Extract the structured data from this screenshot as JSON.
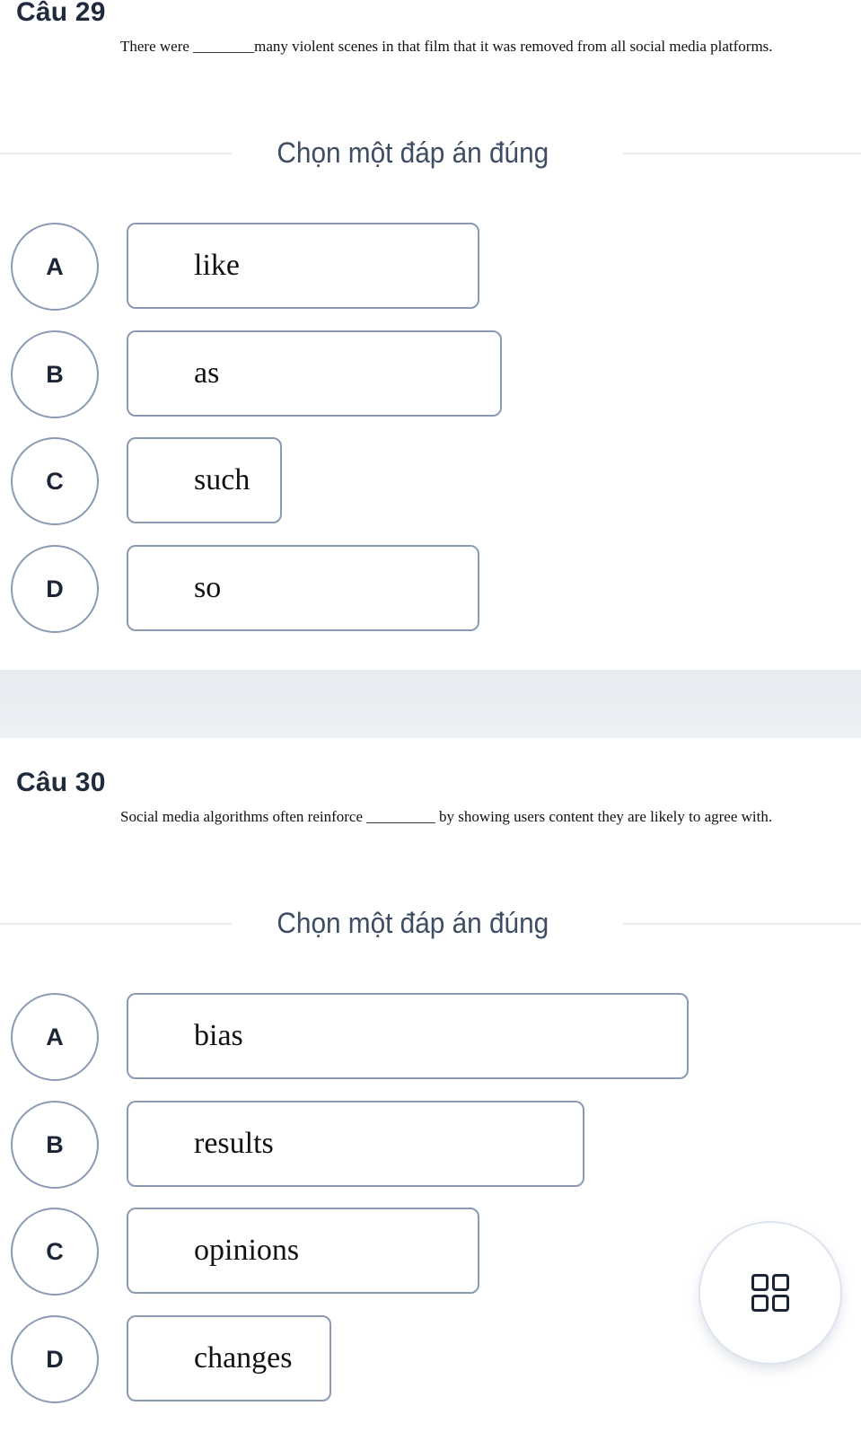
{
  "questions": [
    {
      "title": "Câu 29",
      "text": "There were ________many violent scenes in that film that it was removed from all social media platforms.",
      "instruction": "Chọn một đáp án đúng",
      "options": [
        {
          "letter": "A",
          "text": "like"
        },
        {
          "letter": "B",
          "text": "as"
        },
        {
          "letter": "C",
          "text": "such"
        },
        {
          "letter": "D",
          "text": "so"
        }
      ]
    },
    {
      "title": "Câu 30",
      "text": "Social media algorithms often reinforce _________ by showing users content they are likely to agree with.",
      "instruction": "Chọn một đáp án đúng",
      "options": [
        {
          "letter": "A",
          "text": "bias"
        },
        {
          "letter": "B",
          "text": "results"
        },
        {
          "letter": "C",
          "text": "opinions"
        },
        {
          "letter": "D",
          "text": "changes"
        }
      ]
    }
  ],
  "fab": {
    "icon": "grid-icon"
  }
}
